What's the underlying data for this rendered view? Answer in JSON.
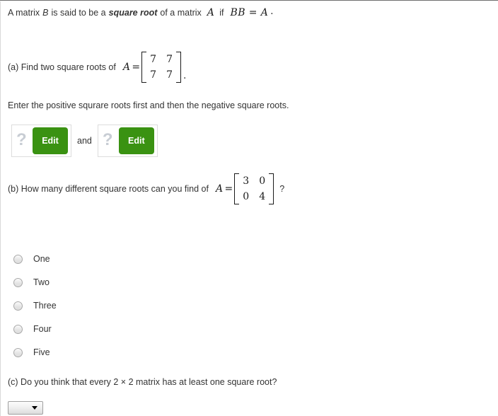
{
  "definition": {
    "part1": "A matrix",
    "var_b": "B",
    "part2": "is said to be a",
    "emphasis": "square root",
    "part3": "of a matrix",
    "var_a": "A",
    "part4": "if",
    "equation": "BB = A",
    "period": "."
  },
  "part_a": {
    "label": "(a) Find two square roots of",
    "matrix_var": "A",
    "equals": "=",
    "matrix": [
      [
        "7",
        "7"
      ],
      [
        "7",
        "7"
      ]
    ],
    "trailing_period": ".",
    "instruction": "Enter the positive squrare roots first and then the negative square roots.",
    "answer_slots": [
      {
        "placeholder": "?",
        "button_label": "Edit"
      },
      {
        "placeholder": "?",
        "button_label": "Edit"
      }
    ],
    "separator": "and"
  },
  "part_b": {
    "label": "(b) How many different square roots can you find of",
    "matrix_var": "A",
    "equals": "=",
    "matrix": [
      [
        "3",
        "0"
      ],
      [
        "0",
        "4"
      ]
    ],
    "question_mark": "?",
    "options": [
      {
        "label": "One",
        "selected": false
      },
      {
        "label": "Two",
        "selected": false
      },
      {
        "label": "Three",
        "selected": false
      },
      {
        "label": "Four",
        "selected": false
      },
      {
        "label": "Five",
        "selected": false
      }
    ]
  },
  "part_c": {
    "label": "(c) Do you think that every 2 × 2 matrix has at least one square root?",
    "dropdown_value": "",
    "dropdown_icon": "caret-down-icon"
  },
  "colors": {
    "accent_green": "#3a9212",
    "text": "#333333",
    "placeholder": "#c8cdd4",
    "border": "#dcdcdc"
  }
}
